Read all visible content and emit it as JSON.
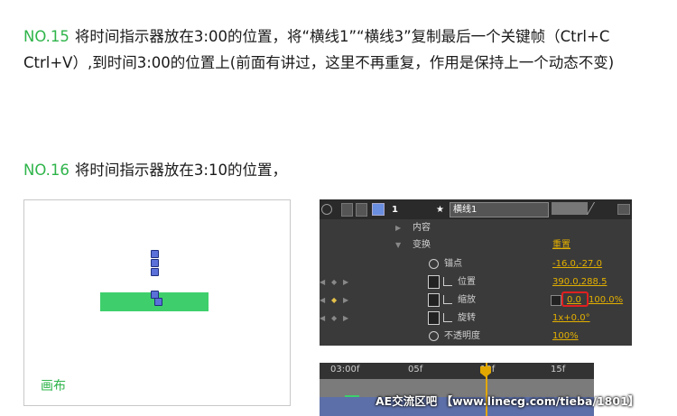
{
  "step15": {
    "num": "NO.15",
    "text": "将时间指示器放在3:00的位置，将“横线1”“横线3”复制最后一个关键帧（Ctrl+C　Ctrl+V）,到时间3:00的位置上(前面有讲过，这里不再重复，作用是保持上一个动态不变)"
  },
  "step16": {
    "num": "NO.16",
    "text": "将时间指示器放在3:10的位置，"
  },
  "canvas": {
    "label": "画布"
  },
  "ae_panel": {
    "layer_num": "1",
    "layer_name": "横线1",
    "rows": {
      "contents": "内容",
      "transform": "变换",
      "reset": "重置",
      "anchor": "锚点",
      "anchor_val": "-16.0,-27.0",
      "position": "位置",
      "position_val": "390.0,288.5",
      "scale": "缩放",
      "scale_x": "0.0",
      "scale_y": "100.0%",
      "rotation": "旋转",
      "rotation_val": "1x+0.0°",
      "opacity": "不透明度",
      "opacity_val": "100%"
    }
  },
  "timeline": {
    "ticks": [
      "03:00f",
      "05f",
      "10f",
      "15f"
    ]
  },
  "watermark": "AE交流区吧 【www.linecg.com/tieba/1801】",
  "colors": {
    "accent_green": "#2fb44a",
    "ae_value": "#e4b000",
    "highlight_box": "#e02020"
  }
}
